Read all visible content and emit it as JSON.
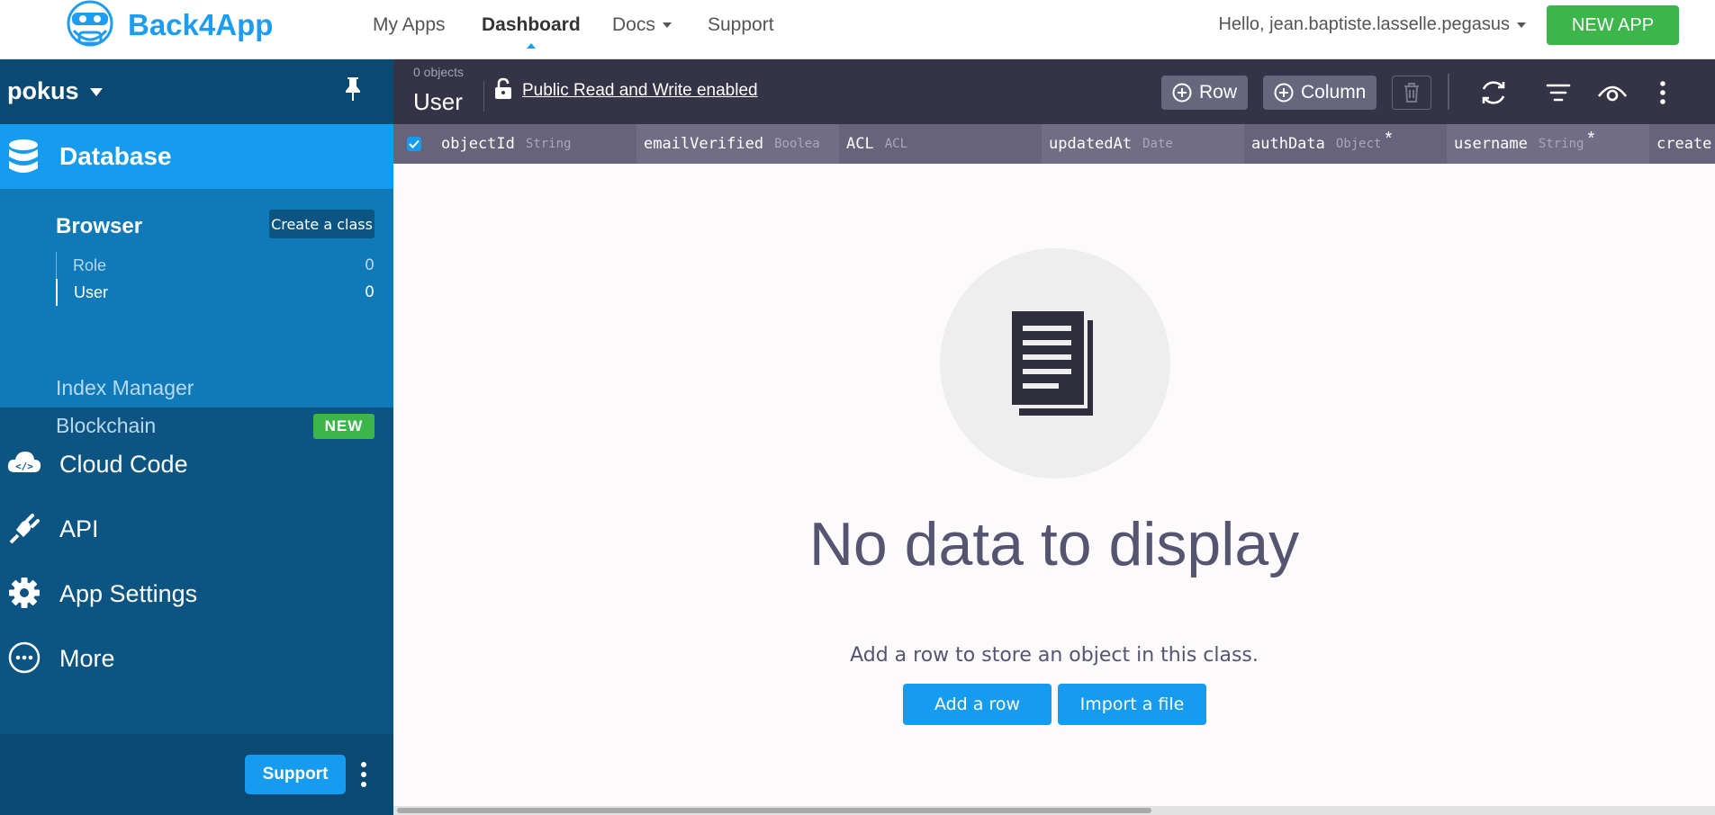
{
  "nav": {
    "brand": "Back4App",
    "links": [
      "My Apps",
      "Dashboard",
      "Docs",
      "Support"
    ],
    "user_greeting": "Hello, jean.baptiste.lasselle.pegasus",
    "new_app": "NEW APP"
  },
  "sidebar": {
    "app_name": "pokus",
    "database": "Database",
    "browser": "Browser",
    "create_class": "Create a class",
    "classes": [
      {
        "name": "Role",
        "count": "0"
      },
      {
        "name": "User",
        "count": "0"
      }
    ],
    "index_manager": "Index Manager",
    "blockchain": "Blockchain",
    "badge_new": "NEW",
    "items": [
      "Cloud Code",
      "API",
      "App Settings",
      "More"
    ],
    "support": "Support"
  },
  "toolbar": {
    "object_count": "0 objects",
    "class_title": "User",
    "public_link": "Public Read and Write enabled",
    "row_button": "Row",
    "column_button": "Column"
  },
  "columns": [
    {
      "name": "objectId",
      "type": "String",
      "required": false
    },
    {
      "name": "emailVerified",
      "type": "Boolea",
      "required": false
    },
    {
      "name": "ACL",
      "type": "ACL",
      "required": false
    },
    {
      "name": "updatedAt",
      "type": "Date",
      "required": false
    },
    {
      "name": "authData",
      "type": "Object",
      "required": true
    },
    {
      "name": "username",
      "type": "String",
      "required": true
    },
    {
      "name": "create",
      "type": "",
      "required": false
    }
  ],
  "empty": {
    "title": "No data to display",
    "subtitle": "Add a row to store an object in this class.",
    "add_row": "Add a row",
    "import_file": "Import a file"
  },
  "colors": {
    "accent": "#169cee",
    "green": "#3cb64a",
    "sidebar": "#0c5582",
    "toolbar": "#353446"
  }
}
